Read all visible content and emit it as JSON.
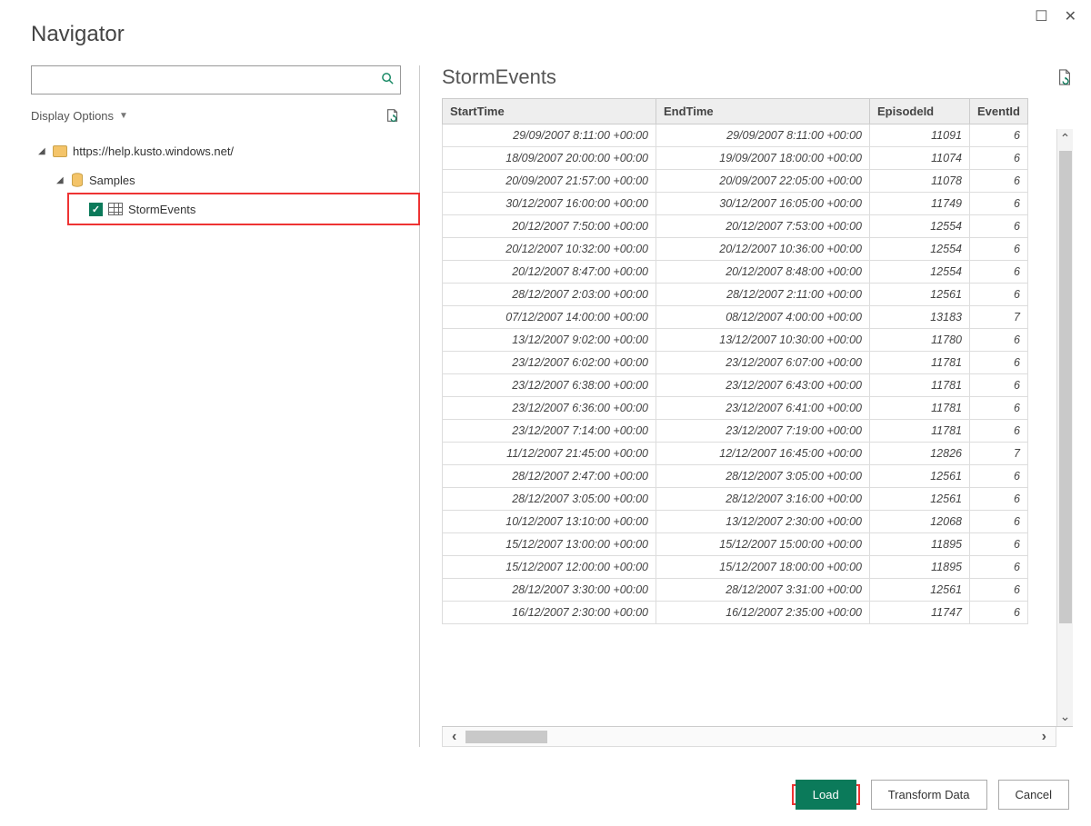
{
  "title": "Navigator",
  "search": {
    "placeholder": ""
  },
  "displayOptions": "Display Options",
  "tree": {
    "root": "https://help.kusto.windows.net/",
    "db": "Samples",
    "table": "StormEvents"
  },
  "preview": {
    "title": "StormEvents",
    "columns": [
      "StartTime",
      "EndTime",
      "EpisodeId",
      "EventId"
    ],
    "partialEventId": "6",
    "rows": [
      {
        "start": "29/09/2007 8:11:00 +00:00",
        "end": "29/09/2007 8:11:00 +00:00",
        "epi": "11091",
        "evt": "6"
      },
      {
        "start": "18/09/2007 20:00:00 +00:00",
        "end": "19/09/2007 18:00:00 +00:00",
        "epi": "11074",
        "evt": "6"
      },
      {
        "start": "20/09/2007 21:57:00 +00:00",
        "end": "20/09/2007 22:05:00 +00:00",
        "epi": "11078",
        "evt": "6"
      },
      {
        "start": "30/12/2007 16:00:00 +00:00",
        "end": "30/12/2007 16:05:00 +00:00",
        "epi": "11749",
        "evt": "6"
      },
      {
        "start": "20/12/2007 7:50:00 +00:00",
        "end": "20/12/2007 7:53:00 +00:00",
        "epi": "12554",
        "evt": "6"
      },
      {
        "start": "20/12/2007 10:32:00 +00:00",
        "end": "20/12/2007 10:36:00 +00:00",
        "epi": "12554",
        "evt": "6"
      },
      {
        "start": "20/12/2007 8:47:00 +00:00",
        "end": "20/12/2007 8:48:00 +00:00",
        "epi": "12554",
        "evt": "6"
      },
      {
        "start": "28/12/2007 2:03:00 +00:00",
        "end": "28/12/2007 2:11:00 +00:00",
        "epi": "12561",
        "evt": "6"
      },
      {
        "start": "07/12/2007 14:00:00 +00:00",
        "end": "08/12/2007 4:00:00 +00:00",
        "epi": "13183",
        "evt": "7"
      },
      {
        "start": "13/12/2007 9:02:00 +00:00",
        "end": "13/12/2007 10:30:00 +00:00",
        "epi": "11780",
        "evt": "6"
      },
      {
        "start": "23/12/2007 6:02:00 +00:00",
        "end": "23/12/2007 6:07:00 +00:00",
        "epi": "11781",
        "evt": "6"
      },
      {
        "start": "23/12/2007 6:38:00 +00:00",
        "end": "23/12/2007 6:43:00 +00:00",
        "epi": "11781",
        "evt": "6"
      },
      {
        "start": "23/12/2007 6:36:00 +00:00",
        "end": "23/12/2007 6:41:00 +00:00",
        "epi": "11781",
        "evt": "6"
      },
      {
        "start": "23/12/2007 7:14:00 +00:00",
        "end": "23/12/2007 7:19:00 +00:00",
        "epi": "11781",
        "evt": "6"
      },
      {
        "start": "11/12/2007 21:45:00 +00:00",
        "end": "12/12/2007 16:45:00 +00:00",
        "epi": "12826",
        "evt": "7"
      },
      {
        "start": "28/12/2007 2:47:00 +00:00",
        "end": "28/12/2007 3:05:00 +00:00",
        "epi": "12561",
        "evt": "6"
      },
      {
        "start": "28/12/2007 3:05:00 +00:00",
        "end": "28/12/2007 3:16:00 +00:00",
        "epi": "12561",
        "evt": "6"
      },
      {
        "start": "10/12/2007 13:10:00 +00:00",
        "end": "13/12/2007 2:30:00 +00:00",
        "epi": "12068",
        "evt": "6"
      },
      {
        "start": "15/12/2007 13:00:00 +00:00",
        "end": "15/12/2007 15:00:00 +00:00",
        "epi": "11895",
        "evt": "6"
      },
      {
        "start": "15/12/2007 12:00:00 +00:00",
        "end": "15/12/2007 18:00:00 +00:00",
        "epi": "11895",
        "evt": "6"
      },
      {
        "start": "28/12/2007 3:30:00 +00:00",
        "end": "28/12/2007 3:31:00 +00:00",
        "epi": "12561",
        "evt": "6"
      },
      {
        "start": "16/12/2007 2:30:00 +00:00",
        "end": "16/12/2007 2:35:00 +00:00",
        "epi": "11747",
        "evt": "6"
      }
    ]
  },
  "buttons": {
    "load": "Load",
    "transform": "Transform Data",
    "cancel": "Cancel"
  }
}
